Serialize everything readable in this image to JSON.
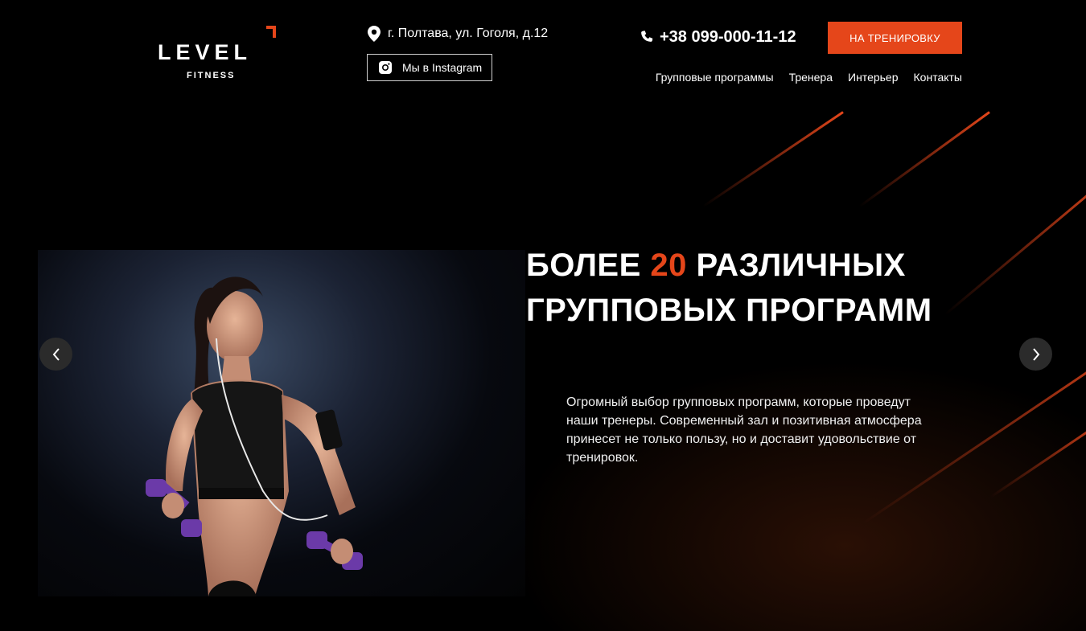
{
  "brand": {
    "name": "LEVEL",
    "sub": "FITNESS",
    "accent_color": "#e5461a"
  },
  "header": {
    "address": "г. Полтава, ул. Гоголя, д.12",
    "address_icon": "map-pin-icon",
    "instagram_label": "Мы в Instagram",
    "instagram_icon": "instagram-icon",
    "phone": "+38 099-000-11-12",
    "phone_icon": "phone-icon",
    "cta_label": "НА ТРЕНИРОВКУ",
    "nav": [
      "Групповые программы",
      "Тренера",
      "Интерьер",
      "Контакты"
    ]
  },
  "hero": {
    "title_pre": "Более",
    "title_number": "20",
    "title_post": "различных групповых программ",
    "description": "Огромный выбор групповых программ, которые проведут наши тренеры. Современный зал и позитивная атмосфера принесет не только пользу, но и доставит удовольствие от тренировок.",
    "prev_icon": "chevron-left-icon",
    "next_icon": "chevron-right-icon"
  }
}
